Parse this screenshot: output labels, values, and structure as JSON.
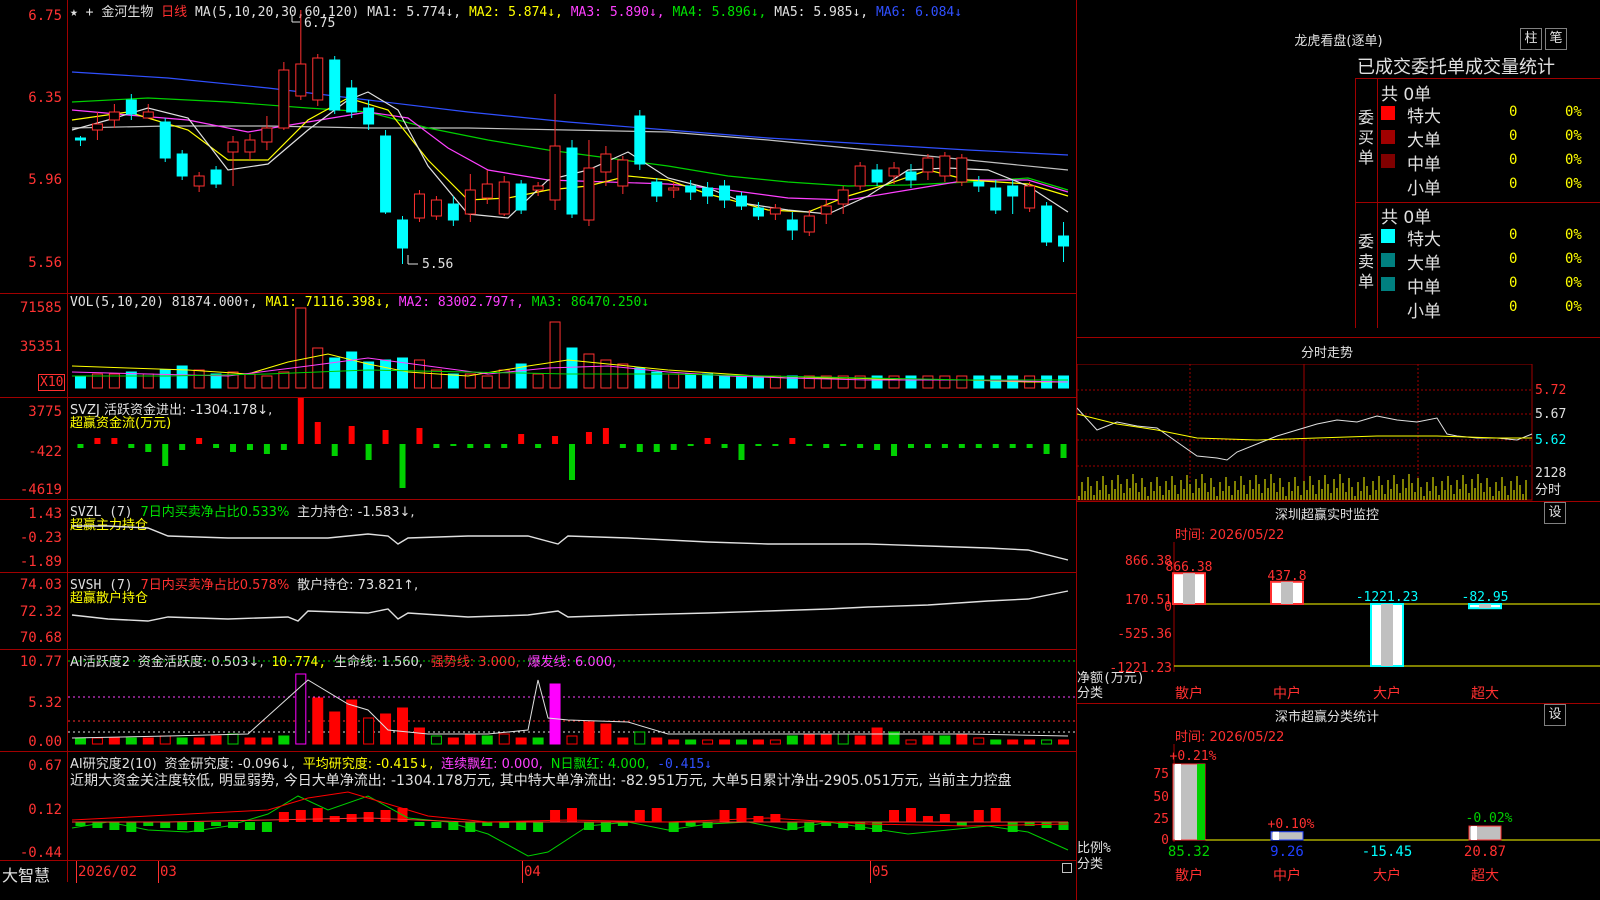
{
  "header": {
    "star": "★",
    "plus": "+",
    "stock_name": "金河生物",
    "period": "日线",
    "ma_label": "MA(5,10,20,30,60,120)",
    "ma1": "MA1: 5.774↓,",
    "ma2": "MA2: 5.874↓,",
    "ma3": "MA3: 5.890↓,",
    "ma4": "MA4: 5.896↓,",
    "ma5": "MA5: 5.985↓,",
    "ma6": "MA6: 6.084↓"
  },
  "price_axis": [
    "6.75",
    "6.35",
    "5.96",
    "5.56"
  ],
  "price_high_label": "6.75",
  "price_low_label": "5.56",
  "vol": {
    "header": "VOL(5,10,20)",
    "value": "81874.000↑,",
    "ma1": "MA1: 71116.398↓,",
    "ma2": "MA2: 83002.797↑,",
    "ma3": "MA3: 86470.250↓",
    "axis": [
      "71585",
      "35351"
    ],
    "unit": "X10"
  },
  "svzj": {
    "header": "SVZJ  活跃资金进出: -1304.178↓,",
    "subtitle": "超赢资金流(万元)",
    "axis": [
      "3775",
      "-422",
      "-4619"
    ]
  },
  "svzl": {
    "header1": "SVZL (7)",
    "header2": "7日内买卖净占比0.533%",
    "header3": "主力持仓: -1.583↓,",
    "subtitle": "超赢主力持仓",
    "axis": [
      "1.43",
      "-0.23",
      "-1.89"
    ]
  },
  "svsh": {
    "header1": "SVSH (7)",
    "header2": "7日内买卖净占比0.578%",
    "header3": "散户持仓: 73.821↑,",
    "subtitle": "超赢散户持仓",
    "axis": [
      "74.03",
      "72.32",
      "70.68"
    ]
  },
  "ai_active": {
    "h1": "AI活跃度2",
    "h2": "资金活跃度: 0.503↓,",
    "h3": "10.774,",
    "h4": "生命线: 1.560,",
    "h5": "强势线: 3.000,",
    "h6": "爆发线: 6.000,",
    "axis": [
      "10.77",
      "5.32",
      "0.00"
    ]
  },
  "ai_research": {
    "h1": "AI研究度2(10)",
    "h2": "资金研究度: -0.096↓,",
    "h3": "平均研究度: -0.415↓,",
    "h4": "连续飘红: 0.000,",
    "h5": "N日飘红: 4.000,",
    "h6": "-0.415↓",
    "comment": "近期大资金关注度较低, 明显弱势, 今日大单净流出: -1304.178万元, 其中特大单净流出: -82.951万元, 大单5日累计净出-2905.051万元, 当前主力控盘",
    "axis": [
      "0.67",
      "0.12",
      "-0.44"
    ]
  },
  "footer": {
    "brand": "大智慧",
    "dates": [
      "2026/02",
      "03",
      "04",
      "05"
    ]
  },
  "right": {
    "longhu_title": "龙虎看盘(逐单)",
    "btn_zhu": "柱",
    "btn_bi": "笔",
    "subtitle": "已成交委托单成交量统计",
    "buy_label": "委买单",
    "sell_label": "委卖单",
    "buy_total": "共 0单",
    "sell_total": "共 0单",
    "buy_rows": [
      {
        "name": "特大",
        "count": "0",
        "pct": "0%",
        "color": "#ff0000"
      },
      {
        "name": "大单",
        "count": "0",
        "pct": "0%",
        "color": "#a00000"
      },
      {
        "name": "中单",
        "count": "0",
        "pct": "0%",
        "color": "#800000"
      },
      {
        "name": "小单",
        "count": "0",
        "pct": "0%",
        "color": "#000000"
      }
    ],
    "sell_rows": [
      {
        "name": "特大",
        "count": "0",
        "pct": "0%",
        "color": "#00ffff"
      },
      {
        "name": "大单",
        "count": "0",
        "pct": "0%",
        "color": "#008080"
      },
      {
        "name": "中单",
        "count": "0",
        "pct": "0%",
        "color": "#008080"
      },
      {
        "name": "小单",
        "count": "0",
        "pct": "0%",
        "color": "#000000"
      }
    ],
    "intraday_title": "分时走势",
    "intraday_axis": [
      "5.72",
      "5.67",
      "5.62",
      "2128",
      "分时"
    ],
    "sz_monitor_title": "深圳超赢实时监控",
    "sz_btn": "设",
    "sz_time": "时间: 2026/05/22",
    "sz_axis": [
      "866.38",
      "170.51",
      "0",
      "-525.36",
      "-1221.23"
    ],
    "sz_ylabel1": "净额(万元)",
    "sz_ylabel2": "分类",
    "sz_values": [
      "866.38",
      "437.8",
      "-1221.23",
      "-82.95"
    ],
    "sz_cats": [
      "散户",
      "中户",
      "大户",
      "超大"
    ],
    "cls_title": "深市超赢分类统计",
    "cls_btn": "设",
    "cls_time": "时间: 2026/05/22",
    "cls_axis": [
      "75",
      "50",
      "25",
      "0"
    ],
    "cls_top": [
      "+0.21%",
      "+0.10%",
      "-0.02%"
    ],
    "cls_values": [
      "85.32",
      "9.26",
      "-15.45",
      "20.87"
    ],
    "cls_ylabel1": "比例%",
    "cls_ylabel2": "分类",
    "cls_cats": [
      "散户",
      "中户",
      "大户",
      "超大"
    ]
  }
}
